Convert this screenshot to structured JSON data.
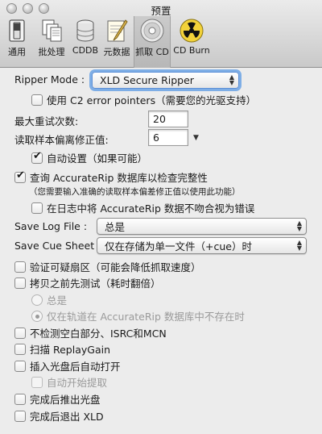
{
  "window": {
    "title": "预置"
  },
  "toolbar": {
    "items": [
      {
        "label": "通用",
        "icon": "general-switch-icon"
      },
      {
        "label": "批处理",
        "icon": "batch-documents-icon"
      },
      {
        "label": "CDDB",
        "icon": "database-icon"
      },
      {
        "label": "元数据",
        "icon": "metadata-pen-icon"
      },
      {
        "label": "抓取 CD",
        "icon": "cd-disc-icon"
      },
      {
        "label": "CD Burn",
        "icon": "radiation-burn-icon"
      }
    ],
    "selected": "抓取 CD"
  },
  "ripper": {
    "mode_label": "Ripper Mode :",
    "mode_value": "XLD Secure Ripper",
    "c2_label": "使用 C2 error pointers（需要您的光驱支持）",
    "c2_checked": false,
    "max_retry_label": "最大重试次数:",
    "max_retry_value": "20",
    "offset_label": "读取样本偏离修正值:",
    "offset_value": "6",
    "auto_set_label": "自动设置（如果可能）",
    "auto_set_checked": true
  },
  "accuraterip": {
    "query_label": "查询 AccurateRip 数据库以检查完整性",
    "query_checked": true,
    "query_note": "（您需要输入准确的读取样本偏差修正值以使用此功能）",
    "mismatch_label": "在日志中将 AccurateRip 数据不吻合视为错误",
    "mismatch_checked": false
  },
  "save": {
    "log_label": "Save Log File :",
    "log_value": "总是",
    "cue_label": "Save Cue Sheet :",
    "cue_value": "仅在存储为单一文件（+cue）时"
  },
  "options": {
    "verify_label": "验证可疑扇区（可能会降低抓取速度）",
    "verify_checked": false,
    "test_before_label": "拷贝之前先测试（耗时翻倍）",
    "test_before_checked": false,
    "radio_always_label": "总是",
    "radio_not_in_db_label": "仅在轨道在 AccurateRip 数据库中不存在时",
    "radio_selected": "not_in_db",
    "no_detect_label": "不检测空白部分、ISRC和MCN",
    "no_detect_checked": false,
    "replaygain_label": "扫描 ReplayGain",
    "replaygain_checked": false,
    "auto_open_label": "插入光盘后自动打开",
    "auto_open_checked": false,
    "auto_start_label": "自动开始提取",
    "auto_start_checked": false,
    "eject_label": "完成后推出光盘",
    "eject_checked": false,
    "quit_label": "完成后退出 XLD",
    "quit_checked": false
  }
}
